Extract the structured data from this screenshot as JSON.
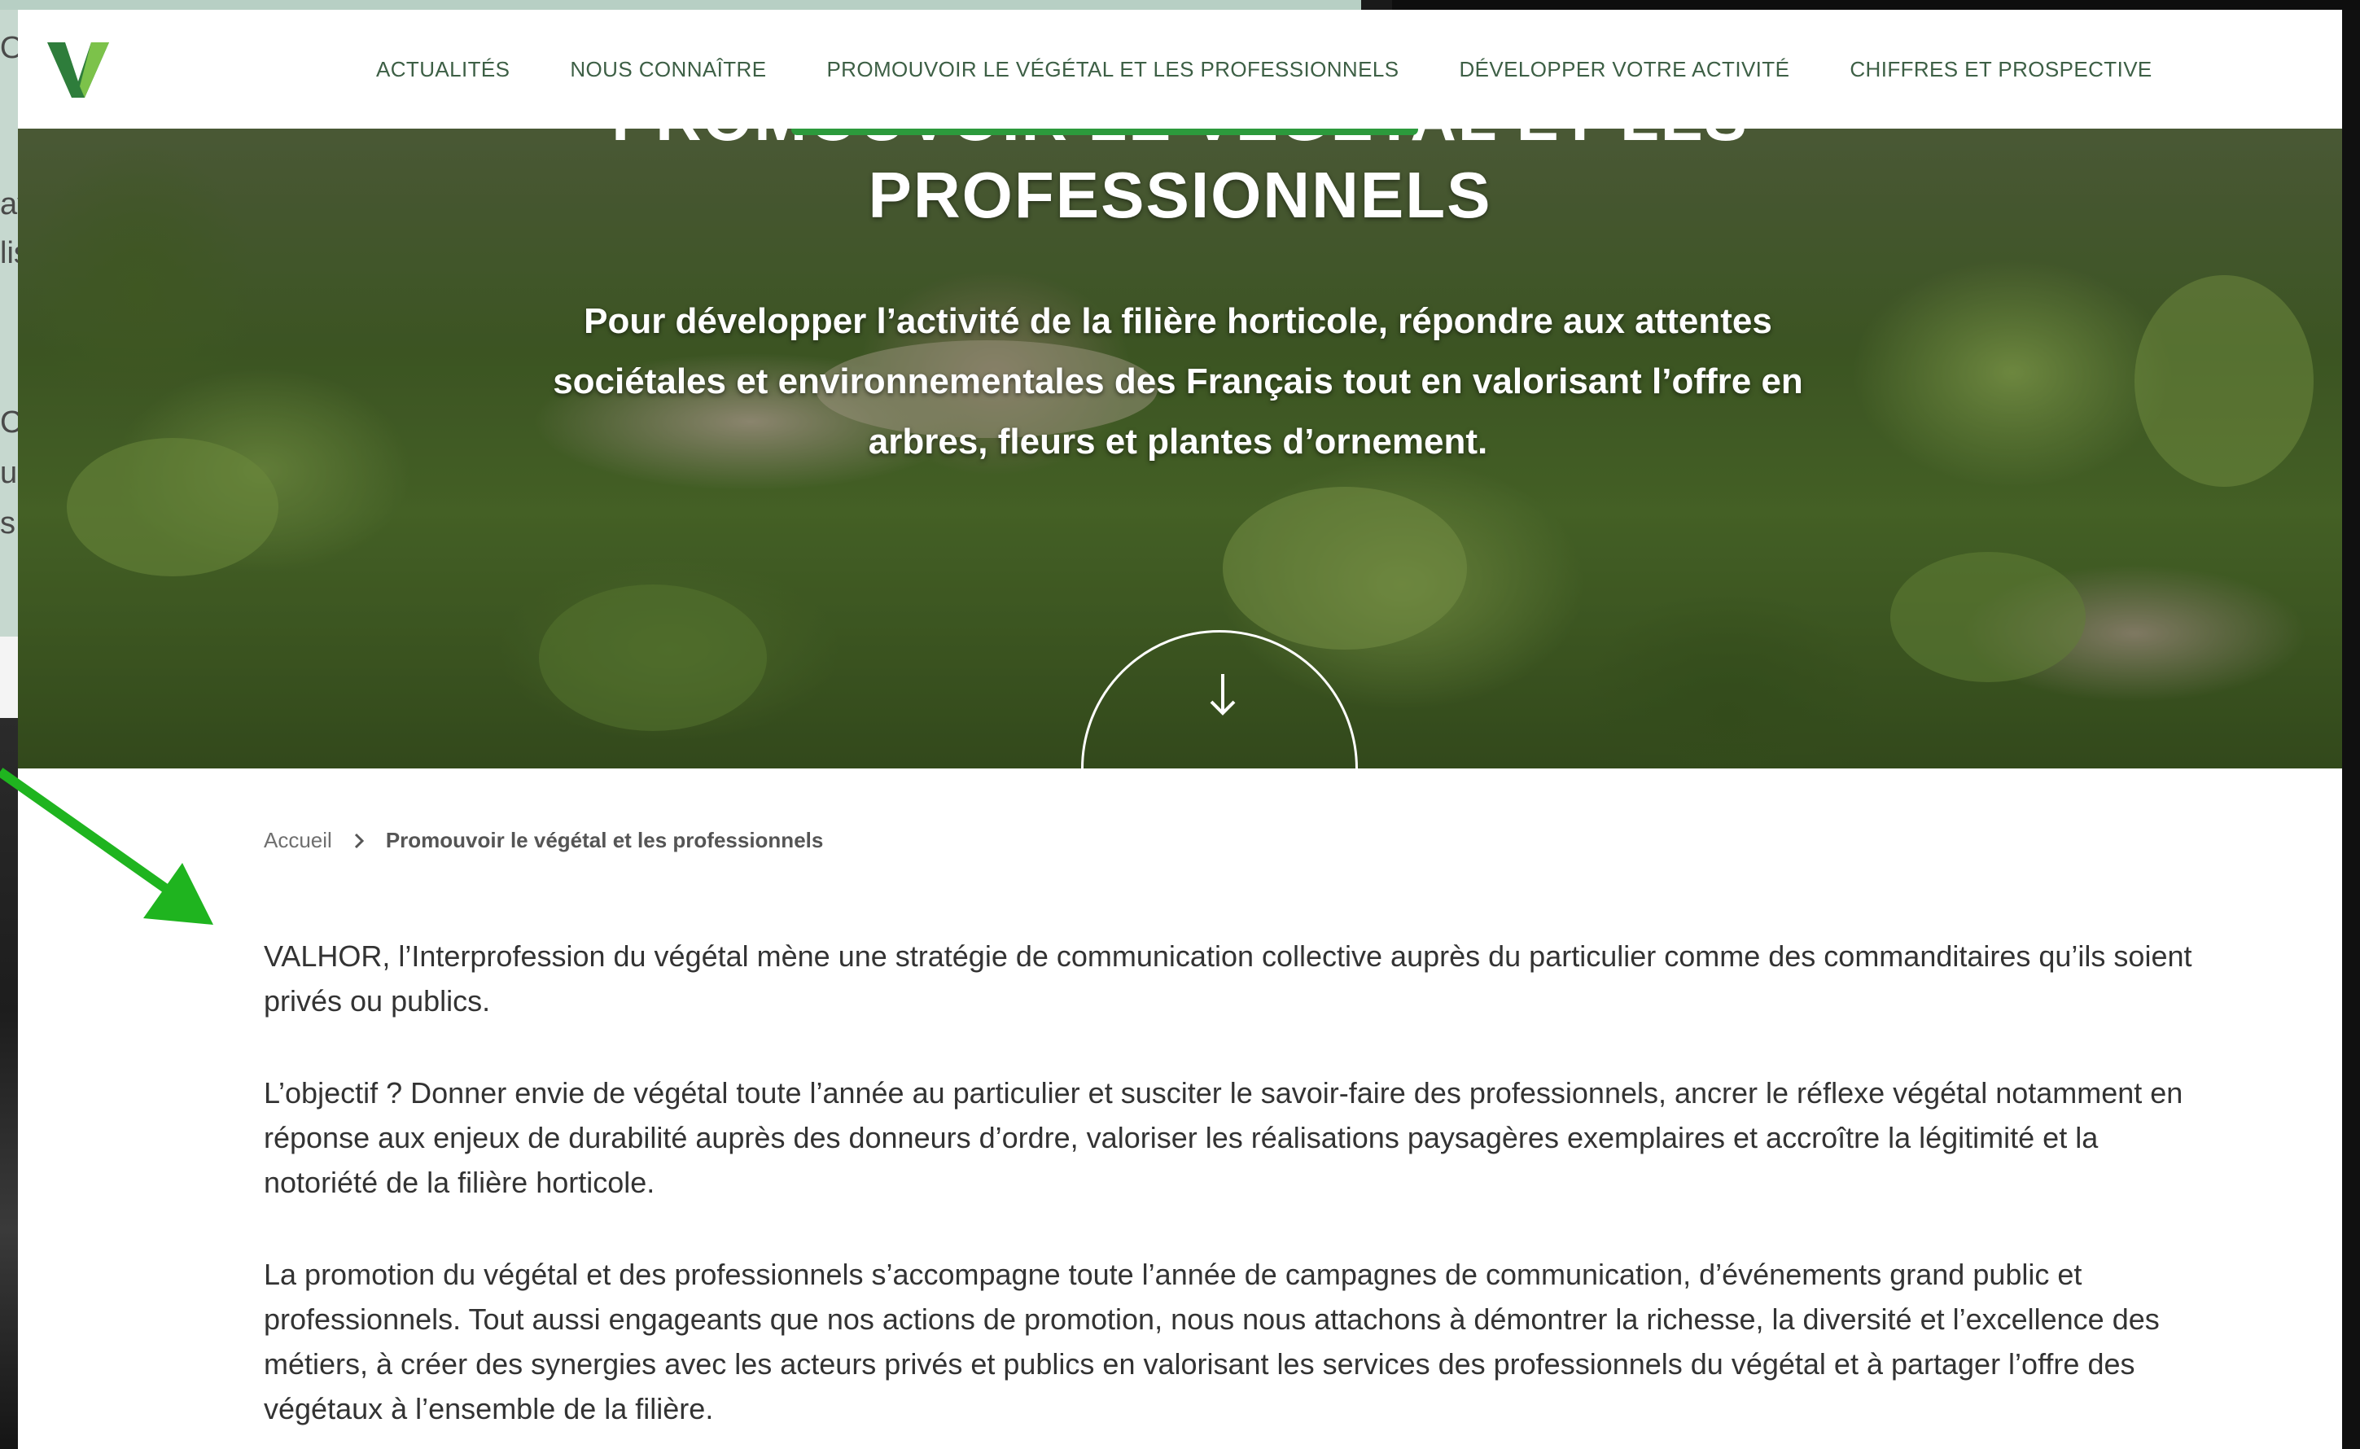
{
  "background": {
    "left_fragments": [
      "O",
      "av",
      "lis",
      "C",
      "us",
      "s"
    ]
  },
  "colors": {
    "brand_green": "#2c9a3c",
    "nav_text": "#3d5f45",
    "annotation_arrow": "#1fb41f"
  },
  "header": {
    "logo_letter": "V",
    "nav": [
      {
        "label": "ACTUALITÉS"
      },
      {
        "label": "NOUS CONNAÎTRE"
      },
      {
        "label": "PROMOUVOIR LE VÉGÉTAL ET LES PROFESSIONNELS"
      },
      {
        "label": "DÉVELOPPER VOTRE ACTIVITÉ"
      },
      {
        "label": "CHIFFRES ET PROSPECTIVE"
      }
    ]
  },
  "hero": {
    "title_partial": "PROMOUVOIR LE VÉGÉTAL ET LES",
    "title": "PROFESSIONNELS",
    "subtitle": "Pour développer l’activité de la filière horticole, répondre aux attentes sociétales et environnementales des Français tout en valorisant l’offre en arbres, fleurs et plantes d’ornement.",
    "scroll_icon": "arrow-down-icon"
  },
  "breadcrumb": {
    "home": "Accueil",
    "separator_icon": "chevron-right-icon",
    "current": "Promouvoir le végétal et les professionnels"
  },
  "content": {
    "paragraphs": [
      "VALHOR, l’Interprofession du végétal mène une stratégie de communication collective auprès du particulier comme des commanditaires qu’ils soient privés ou publics.",
      "L’objectif ? Donner envie de végétal toute l’année au particulier et susciter le savoir-faire des professionnels, ancrer le réflexe végétal notamment en réponse aux enjeux de durabilité auprès des donneurs d’ordre, valoriser les réalisations paysagères exemplaires et accroître la légitimité et la notoriété de la filière horticole.",
      "La promotion du végétal et des professionnels s’accompagne toute l’année de campagnes de communication, d’événements grand public et professionnels. Tout aussi engageants que nos actions de promotion, nous nous attachons à démontrer la richesse, la diversité et l’excellence des métiers,  à créer des synergies avec les acteurs privés et publics en valorisant les services des professionnels du végétal et à partager l’offre des végétaux à l’ensemble de la filière."
    ]
  }
}
